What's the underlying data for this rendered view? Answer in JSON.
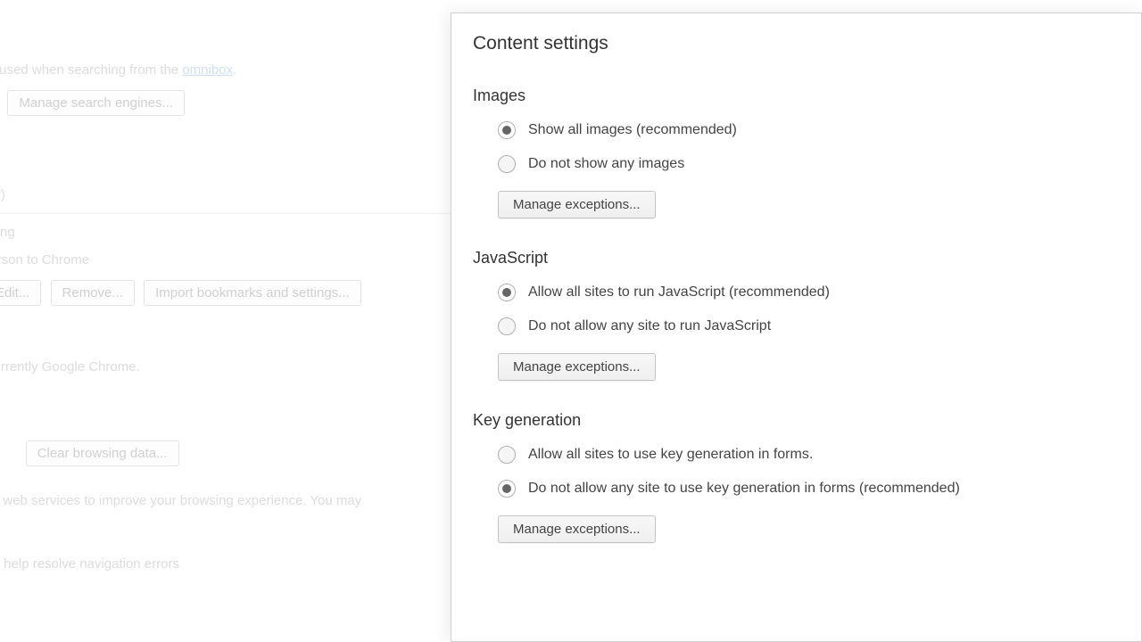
{
  "background": {
    "omnibox_text_prefix": "ine is used when searching from the ",
    "omnibox_link": "omnibox",
    "manage_search_engines": "Manage search engines...",
    "ent_label": "ent)",
    "owsing": "owsing",
    "add_person": " person to Chrome",
    "edit_btn": "Edit...",
    "remove_btn": "Remove...",
    "import_btn": "Import bookmarks and settings...",
    "default_browser": "is currently Google Chrome.",
    "clear_data": "Clear browsing data...",
    "webservices": " use web services to improve your browsing experience. You may",
    "nav_errors": "e to help resolve navigation errors"
  },
  "modal": {
    "title": "Content settings",
    "manage_label": "Manage exceptions...",
    "sections": {
      "images": {
        "title": "Images",
        "opt1": "Show all images (recommended)",
        "opt2": "Do not show any images",
        "selected": 0
      },
      "javascript": {
        "title": "JavaScript",
        "opt1": "Allow all sites to run JavaScript (recommended)",
        "opt2": "Do not allow any site to run JavaScript",
        "selected": 0
      },
      "keygen": {
        "title": "Key generation",
        "opt1": "Allow all sites to use key generation in forms.",
        "opt2": "Do not allow any site to use key generation in forms (recommended)",
        "selected": 1
      }
    }
  }
}
